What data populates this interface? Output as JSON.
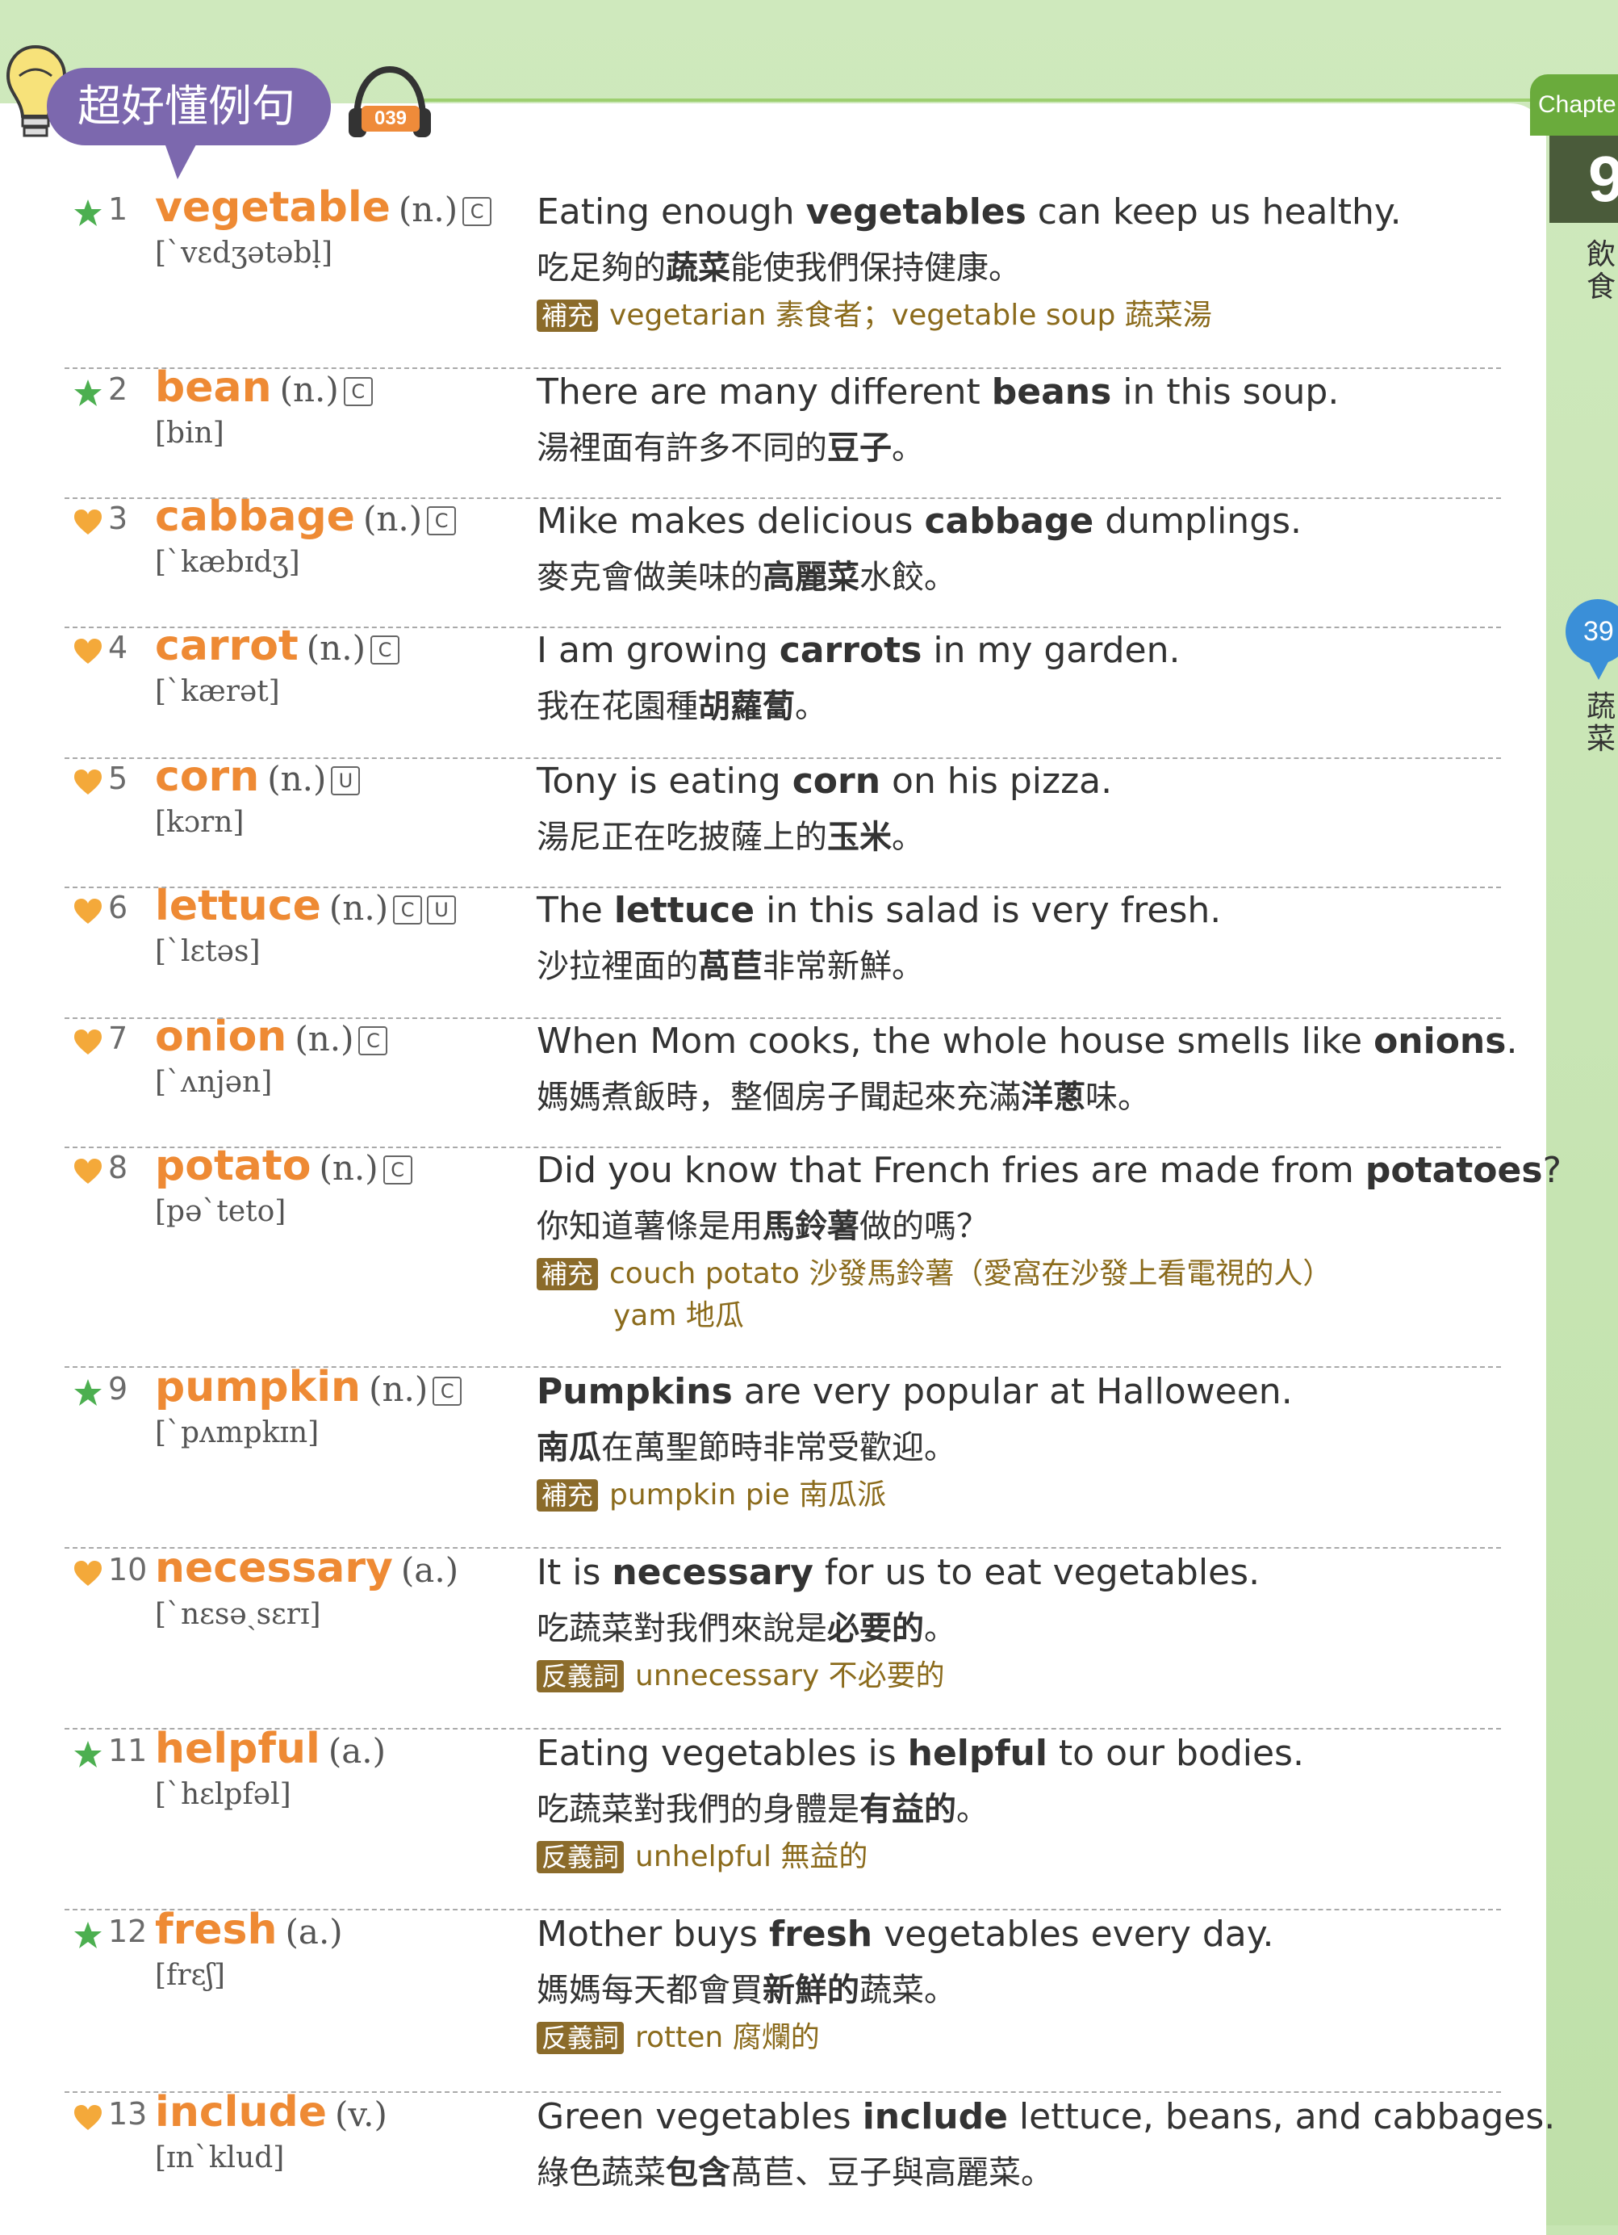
{
  "header": {
    "title": "超好懂例句",
    "track": "039"
  },
  "side": {
    "chapter_label": "Chapte",
    "chapter_number": "9",
    "chapter_name": "飲食",
    "section_number": "39",
    "section_name": "蔬菜"
  },
  "colors": {
    "accent_orange": "#ee8a34",
    "star_green": "#4caf50",
    "heart_orange": "#f4a93a",
    "title_purple": "#7c68ae"
  },
  "entries": [
    {
      "mark": "star",
      "num": "1",
      "word": "vegetable",
      "pos": "(n.)",
      "count": [
        "C"
      ],
      "ipa": "[ˋvɛdʒətəbḷ]",
      "en": [
        {
          "t": "Eating enough "
        },
        {
          "b": "vegetables"
        },
        {
          "t": " can keep us healthy."
        }
      ],
      "zh": [
        {
          "t": "吃足夠的"
        },
        {
          "b": "蔬菜"
        },
        {
          "t": "能使我們保持健康。"
        }
      ],
      "note_tag": "補充",
      "note": "vegetarian 素食者；vegetable soup 蔬菜湯",
      "note2": ""
    },
    {
      "mark": "star",
      "num": "2",
      "word": "bean",
      "pos": "(n.)",
      "count": [
        "C"
      ],
      "ipa": "[bin]",
      "en": [
        {
          "t": "There are many different "
        },
        {
          "b": "beans"
        },
        {
          "t": " in this soup."
        }
      ],
      "zh": [
        {
          "t": "湯裡面有許多不同的"
        },
        {
          "b": "豆子"
        },
        {
          "t": "。"
        }
      ],
      "note_tag": "",
      "note": "",
      "note2": ""
    },
    {
      "mark": "heart",
      "num": "3",
      "word": "cabbage",
      "pos": "(n.)",
      "count": [
        "C"
      ],
      "ipa": "[ˋkæbɪdʒ]",
      "en": [
        {
          "t": "Mike makes delicious "
        },
        {
          "b": "cabbage"
        },
        {
          "t": " dumplings."
        }
      ],
      "zh": [
        {
          "t": "麥克會做美味的"
        },
        {
          "b": "高麗菜"
        },
        {
          "t": "水餃。"
        }
      ],
      "note_tag": "",
      "note": "",
      "note2": ""
    },
    {
      "mark": "heart",
      "num": "4",
      "word": "carrot",
      "pos": "(n.)",
      "count": [
        "C"
      ],
      "ipa": "[ˋkærət]",
      "en": [
        {
          "t": "I am growing "
        },
        {
          "b": "carrots"
        },
        {
          "t": " in my garden."
        }
      ],
      "zh": [
        {
          "t": "我在花園種"
        },
        {
          "b": "胡蘿蔔"
        },
        {
          "t": "。"
        }
      ],
      "note_tag": "",
      "note": "",
      "note2": ""
    },
    {
      "mark": "heart",
      "num": "5",
      "word": "corn",
      "pos": "(n.)",
      "count": [
        "U"
      ],
      "ipa": "[kɔrn]",
      "en": [
        {
          "t": "Tony is eating "
        },
        {
          "b": "corn"
        },
        {
          "t": " on his pizza."
        }
      ],
      "zh": [
        {
          "t": "湯尼正在吃披薩上的"
        },
        {
          "b": "玉米"
        },
        {
          "t": "。"
        }
      ],
      "note_tag": "",
      "note": "",
      "note2": ""
    },
    {
      "mark": "heart",
      "num": "6",
      "word": "lettuce",
      "pos": "(n.)",
      "count": [
        "C",
        "U"
      ],
      "ipa": "[ˋlɛtəs]",
      "en": [
        {
          "t": "The "
        },
        {
          "b": "lettuce"
        },
        {
          "t": " in this salad is very fresh."
        }
      ],
      "zh": [
        {
          "t": "沙拉裡面的"
        },
        {
          "b": "萵苣"
        },
        {
          "t": "非常新鮮。"
        }
      ],
      "note_tag": "",
      "note": "",
      "note2": ""
    },
    {
      "mark": "heart",
      "num": "7",
      "word": "onion",
      "pos": "(n.)",
      "count": [
        "C"
      ],
      "ipa": "[ˋʌnjən]",
      "en": [
        {
          "t": "When Mom cooks, the whole house smells like "
        },
        {
          "b": "onions"
        },
        {
          "t": "."
        }
      ],
      "zh": [
        {
          "t": "媽媽煮飯時，整個房子聞起來充滿"
        },
        {
          "b": "洋蔥"
        },
        {
          "t": "味。"
        }
      ],
      "note_tag": "",
      "note": "",
      "note2": ""
    },
    {
      "mark": "heart",
      "num": "8",
      "word": "potato",
      "pos": "(n.)",
      "count": [
        "C"
      ],
      "ipa": "[pəˋteto]",
      "en": [
        {
          "t": "Did you know that French fries are made from "
        },
        {
          "b": "potatoes"
        },
        {
          "t": "?"
        }
      ],
      "zh": [
        {
          "t": "你知道薯條是用"
        },
        {
          "b": "馬鈴薯"
        },
        {
          "t": "做的嗎？"
        }
      ],
      "note_tag": "補充",
      "note": "couch potato 沙發馬鈴薯（愛窩在沙發上看電視的人）",
      "note2": "yam 地瓜"
    },
    {
      "mark": "star",
      "num": "9",
      "word": "pumpkin",
      "pos": "(n.)",
      "count": [
        "C"
      ],
      "ipa": "[ˋpʌmpkɪn]",
      "en": [
        {
          "b": "Pumpkins"
        },
        {
          "t": " are very popular at Halloween."
        }
      ],
      "zh": [
        {
          "b": "南瓜"
        },
        {
          "t": "在萬聖節時非常受歡迎。"
        }
      ],
      "note_tag": "補充",
      "note": "pumpkin pie 南瓜派",
      "note2": ""
    },
    {
      "mark": "heart",
      "num": "10",
      "word": "necessary",
      "pos": "(a.)",
      "count": [],
      "ipa": "[ˋnɛsəˏsɛrɪ]",
      "en": [
        {
          "t": "It is "
        },
        {
          "b": "necessary"
        },
        {
          "t": " for us to eat vegetables."
        }
      ],
      "zh": [
        {
          "t": "吃蔬菜對我們來說是"
        },
        {
          "b": "必要的"
        },
        {
          "t": "。"
        }
      ],
      "note_tag": "反義詞",
      "note": "unnecessary 不必要的",
      "note2": ""
    },
    {
      "mark": "star",
      "num": "11",
      "word": "helpful",
      "pos": "(a.)",
      "count": [],
      "ipa": "[ˋhɛlpfəl]",
      "en": [
        {
          "t": "Eating vegetables is "
        },
        {
          "b": "helpful"
        },
        {
          "t": " to our bodies."
        }
      ],
      "zh": [
        {
          "t": "吃蔬菜對我們的身體是"
        },
        {
          "b": "有益的"
        },
        {
          "t": "。"
        }
      ],
      "note_tag": "反義詞",
      "note": "unhelpful 無益的",
      "note2": ""
    },
    {
      "mark": "star",
      "num": "12",
      "word": "fresh",
      "pos": "(a.)",
      "count": [],
      "ipa": "[frɛʃ]",
      "en": [
        {
          "t": "Mother buys "
        },
        {
          "b": "fresh"
        },
        {
          "t": " vegetables every day."
        }
      ],
      "zh": [
        {
          "t": "媽媽每天都會買"
        },
        {
          "b": "新鮮的"
        },
        {
          "t": "蔬菜。"
        }
      ],
      "note_tag": "反義詞",
      "note": "rotten 腐爛的",
      "note2": ""
    },
    {
      "mark": "heart",
      "num": "13",
      "word": "include",
      "pos": "(v.)",
      "count": [],
      "ipa": "[ɪnˋklud]",
      "en": [
        {
          "t": "Green vegetables "
        },
        {
          "b": "include"
        },
        {
          "t": " lettuce, beans, and cabbages."
        }
      ],
      "zh": [
        {
          "t": "綠色蔬菜"
        },
        {
          "b": "包含"
        },
        {
          "t": "萵苣、豆子與高麗菜。"
        }
      ],
      "note_tag": "",
      "note": "",
      "note2": ""
    }
  ]
}
